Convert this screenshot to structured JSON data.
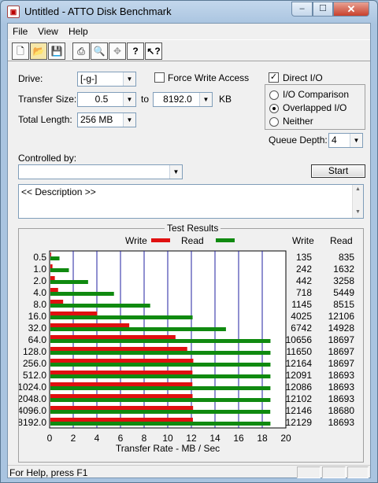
{
  "window": {
    "title": "Untitled - ATTO Disk Benchmark",
    "minimize": "–",
    "maximize": "☐",
    "close": "✕"
  },
  "menu": [
    "File",
    "View",
    "Help"
  ],
  "toolbar_icons": [
    "new-icon",
    "open-icon",
    "save-icon",
    "print-icon",
    "print-preview-icon",
    "move-icon",
    "help-icon",
    "context-help-icon"
  ],
  "form": {
    "drive_label": "Drive:",
    "drive_value": "[-g-]",
    "force_write_label": "Force Write Access",
    "force_write_checked": false,
    "transfer_size_label": "Transfer Size:",
    "transfer_from": "0.5",
    "to_label": "to",
    "transfer_to": "8192.0",
    "unit": "KB",
    "total_length_label": "Total Length:",
    "total_length_value": "256 MB",
    "direct_io_label": "Direct I/O",
    "direct_io_checked": true,
    "io_comparison_label": "I/O Comparison",
    "overlapped_label": "Overlapped I/O",
    "neither_label": "Neither",
    "selected_mode": "overlapped",
    "queue_depth_label": "Queue Depth:",
    "queue_depth_value": "4",
    "controlled_by_label": "Controlled by:",
    "controlled_by_value": "",
    "start_label": "Start",
    "description": "<< Description >>"
  },
  "results": {
    "title": "Test Results",
    "write_legend": "Write",
    "read_legend": "Read",
    "write_col": "Write",
    "read_col": "Read"
  },
  "chart_data": {
    "type": "bar",
    "xlabel": "Transfer Rate - MB / Sec",
    "xlim": [
      0,
      20
    ],
    "xticks": [
      0,
      2,
      4,
      6,
      8,
      10,
      12,
      14,
      16,
      18,
      20
    ],
    "categories": [
      "0.5",
      "1.0",
      "2.0",
      "4.0",
      "8.0",
      "16.0",
      "32.0",
      "64.0",
      "128.0",
      "256.0",
      "512.0",
      "1024.0",
      "2048.0",
      "4096.0",
      "8192.0"
    ],
    "series": [
      {
        "name": "Write",
        "color": "#e01010",
        "values": [
          135,
          242,
          442,
          718,
          1145,
          4025,
          6742,
          10656,
          11650,
          12164,
          12091,
          12086,
          12102,
          12146,
          12129
        ]
      },
      {
        "name": "Read",
        "color": "#108a10",
        "values": [
          835,
          1632,
          3258,
          5449,
          8515,
          12106,
          14928,
          18697,
          18697,
          18697,
          18693,
          18693,
          18693,
          18680,
          18693
        ]
      }
    ]
  },
  "status": {
    "text": "For Help, press F1"
  }
}
